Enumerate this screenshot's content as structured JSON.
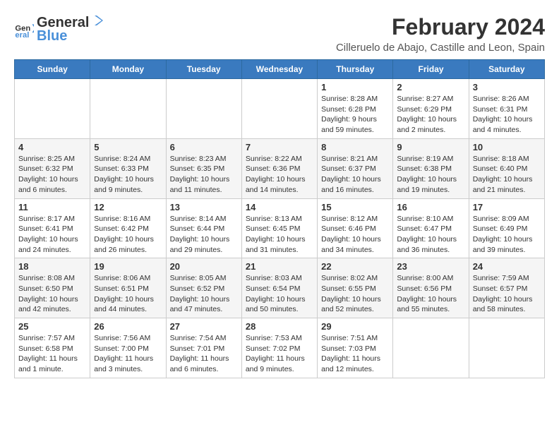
{
  "header": {
    "logo_line1": "General",
    "logo_line2": "Blue",
    "month_year": "February 2024",
    "location": "Cilleruelo de Abajo, Castille and Leon, Spain"
  },
  "weekdays": [
    "Sunday",
    "Monday",
    "Tuesday",
    "Wednesday",
    "Thursday",
    "Friday",
    "Saturday"
  ],
  "weeks": [
    [
      {
        "day": "",
        "info": ""
      },
      {
        "day": "",
        "info": ""
      },
      {
        "day": "",
        "info": ""
      },
      {
        "day": "",
        "info": ""
      },
      {
        "day": "1",
        "info": "Sunrise: 8:28 AM\nSunset: 6:28 PM\nDaylight: 9 hours and 59 minutes."
      },
      {
        "day": "2",
        "info": "Sunrise: 8:27 AM\nSunset: 6:29 PM\nDaylight: 10 hours and 2 minutes."
      },
      {
        "day": "3",
        "info": "Sunrise: 8:26 AM\nSunset: 6:31 PM\nDaylight: 10 hours and 4 minutes."
      }
    ],
    [
      {
        "day": "4",
        "info": "Sunrise: 8:25 AM\nSunset: 6:32 PM\nDaylight: 10 hours and 6 minutes."
      },
      {
        "day": "5",
        "info": "Sunrise: 8:24 AM\nSunset: 6:33 PM\nDaylight: 10 hours and 9 minutes."
      },
      {
        "day": "6",
        "info": "Sunrise: 8:23 AM\nSunset: 6:35 PM\nDaylight: 10 hours and 11 minutes."
      },
      {
        "day": "7",
        "info": "Sunrise: 8:22 AM\nSunset: 6:36 PM\nDaylight: 10 hours and 14 minutes."
      },
      {
        "day": "8",
        "info": "Sunrise: 8:21 AM\nSunset: 6:37 PM\nDaylight: 10 hours and 16 minutes."
      },
      {
        "day": "9",
        "info": "Sunrise: 8:19 AM\nSunset: 6:38 PM\nDaylight: 10 hours and 19 minutes."
      },
      {
        "day": "10",
        "info": "Sunrise: 8:18 AM\nSunset: 6:40 PM\nDaylight: 10 hours and 21 minutes."
      }
    ],
    [
      {
        "day": "11",
        "info": "Sunrise: 8:17 AM\nSunset: 6:41 PM\nDaylight: 10 hours and 24 minutes."
      },
      {
        "day": "12",
        "info": "Sunrise: 8:16 AM\nSunset: 6:42 PM\nDaylight: 10 hours and 26 minutes."
      },
      {
        "day": "13",
        "info": "Sunrise: 8:14 AM\nSunset: 6:44 PM\nDaylight: 10 hours and 29 minutes."
      },
      {
        "day": "14",
        "info": "Sunrise: 8:13 AM\nSunset: 6:45 PM\nDaylight: 10 hours and 31 minutes."
      },
      {
        "day": "15",
        "info": "Sunrise: 8:12 AM\nSunset: 6:46 PM\nDaylight: 10 hours and 34 minutes."
      },
      {
        "day": "16",
        "info": "Sunrise: 8:10 AM\nSunset: 6:47 PM\nDaylight: 10 hours and 36 minutes."
      },
      {
        "day": "17",
        "info": "Sunrise: 8:09 AM\nSunset: 6:49 PM\nDaylight: 10 hours and 39 minutes."
      }
    ],
    [
      {
        "day": "18",
        "info": "Sunrise: 8:08 AM\nSunset: 6:50 PM\nDaylight: 10 hours and 42 minutes."
      },
      {
        "day": "19",
        "info": "Sunrise: 8:06 AM\nSunset: 6:51 PM\nDaylight: 10 hours and 44 minutes."
      },
      {
        "day": "20",
        "info": "Sunrise: 8:05 AM\nSunset: 6:52 PM\nDaylight: 10 hours and 47 minutes."
      },
      {
        "day": "21",
        "info": "Sunrise: 8:03 AM\nSunset: 6:54 PM\nDaylight: 10 hours and 50 minutes."
      },
      {
        "day": "22",
        "info": "Sunrise: 8:02 AM\nSunset: 6:55 PM\nDaylight: 10 hours and 52 minutes."
      },
      {
        "day": "23",
        "info": "Sunrise: 8:00 AM\nSunset: 6:56 PM\nDaylight: 10 hours and 55 minutes."
      },
      {
        "day": "24",
        "info": "Sunrise: 7:59 AM\nSunset: 6:57 PM\nDaylight: 10 hours and 58 minutes."
      }
    ],
    [
      {
        "day": "25",
        "info": "Sunrise: 7:57 AM\nSunset: 6:58 PM\nDaylight: 11 hours and 1 minute."
      },
      {
        "day": "26",
        "info": "Sunrise: 7:56 AM\nSunset: 7:00 PM\nDaylight: 11 hours and 3 minutes."
      },
      {
        "day": "27",
        "info": "Sunrise: 7:54 AM\nSunset: 7:01 PM\nDaylight: 11 hours and 6 minutes."
      },
      {
        "day": "28",
        "info": "Sunrise: 7:53 AM\nSunset: 7:02 PM\nDaylight: 11 hours and 9 minutes."
      },
      {
        "day": "29",
        "info": "Sunrise: 7:51 AM\nSunset: 7:03 PM\nDaylight: 11 hours and 12 minutes."
      },
      {
        "day": "",
        "info": ""
      },
      {
        "day": "",
        "info": ""
      }
    ]
  ]
}
